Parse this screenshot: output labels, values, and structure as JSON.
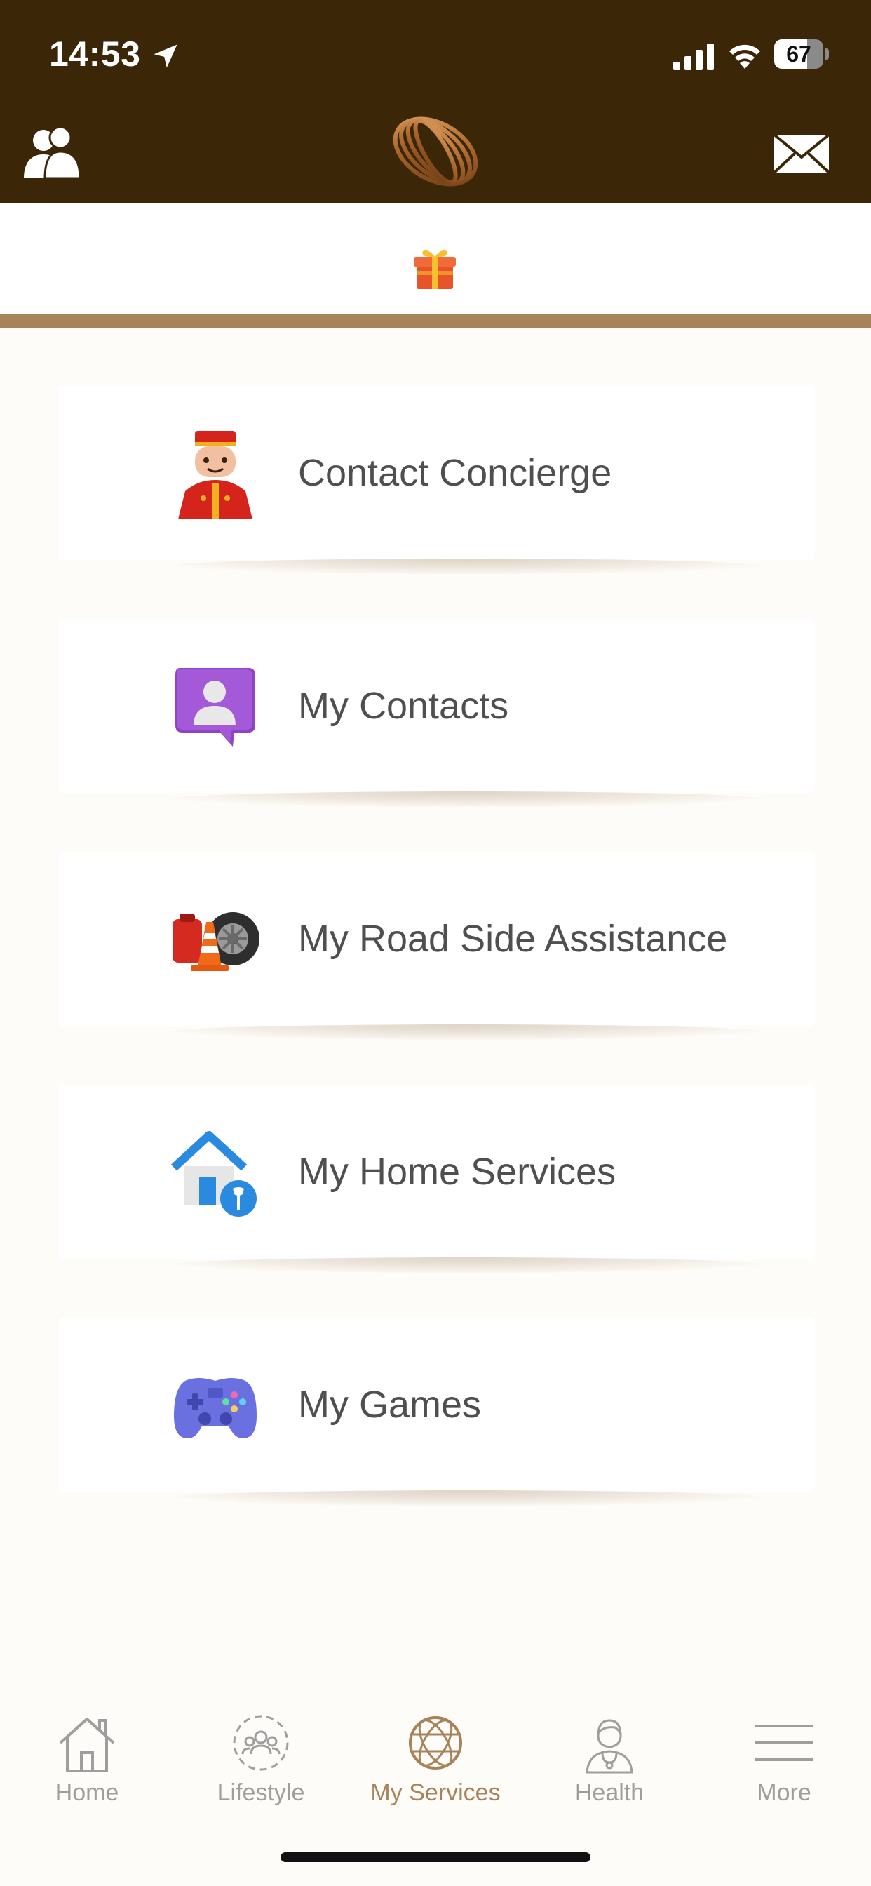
{
  "status_bar": {
    "time": "14:53",
    "battery_percent": 67,
    "battery_text": "67",
    "icons": [
      "location-arrow-icon",
      "cellular-signal-icon",
      "wifi-icon",
      "battery-icon"
    ]
  },
  "header": {
    "left_icon": "profile-users-icon",
    "logo_icon": "brand-ring-logo",
    "right_icon": "mail-icon",
    "background_color": "#3b2608"
  },
  "gift_bar": {
    "icon": "gift-icon",
    "divider_color": "#a8835a"
  },
  "services": [
    {
      "label": "Contact Concierge",
      "icon": "concierge-bellhop-icon"
    },
    {
      "label": "My Contacts",
      "icon": "contacts-chat-icon"
    },
    {
      "label": "My Road Side Assistance",
      "icon": "roadside-tire-cone-icon"
    },
    {
      "label": "My Home Services",
      "icon": "home-wrench-icon"
    },
    {
      "label": "My Games",
      "icon": "gamepad-icon"
    }
  ],
  "tab_bar": {
    "active_index": 2,
    "active_color": "#a8835a",
    "inactive_color": "#9e9e9e",
    "tabs": [
      {
        "label": "Home",
        "icon": "home-icon"
      },
      {
        "label": "Lifestyle",
        "icon": "lifestyle-people-icon"
      },
      {
        "label": "My Services",
        "icon": "globe-icon"
      },
      {
        "label": "Health",
        "icon": "doctor-icon"
      },
      {
        "label": "More",
        "icon": "menu-lines-icon"
      }
    ]
  }
}
